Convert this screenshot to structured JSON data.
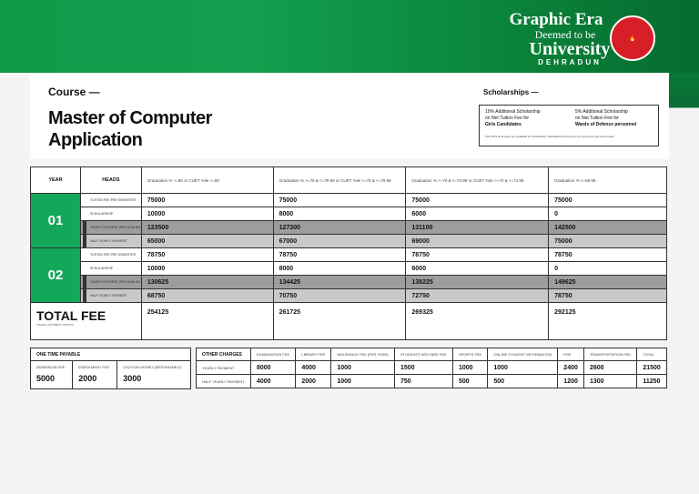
{
  "logo": {
    "name": "Graphic Era",
    "sub": "Deemed to be",
    "uni": "University",
    "city": "DEHRADUN",
    "seal": "GRAPHIC ERA"
  },
  "course_label": "Course —",
  "course_title": "Master of Computer Application",
  "scholarships": {
    "heading": "Scholarships —",
    "items": [
      {
        "line1": "10% Additional Scholarship",
        "line2": "on Net Tuition Fee for",
        "bold": "Girls Candidates"
      },
      {
        "line1": "5% Additional Scholarship",
        "line2": "on Net Tuition Fee for",
        "bold": "Wards of Defence personnel"
      }
    ],
    "note": "Only 25% of all seats are available for scholarship / Scholarship will be given on first come first serve basis."
  },
  "fee_table": {
    "year_header": "YEAR",
    "heads_header": "HEADS",
    "criteria": [
      "Graduation % >=80 or CUET %ile >=80",
      "Graduation % >=75 & <=79.99 or CUET %ile >=75 & <=79.99",
      "Graduation % >=70 & <=74.99 or CUET %ile >=70 & <=74.99",
      "Graduation % <=69.99"
    ],
    "years": [
      {
        "year": "01",
        "rows": [
          {
            "head": "Tuition Fee Per Semester",
            "values": [
              "75000",
              "75000",
              "75000",
              "75000"
            ]
          },
          {
            "head": "Scholarship",
            "values": [
              "10000",
              "8000",
              "6000",
              "0"
            ]
          },
          {
            "head": "Yearly Payment (Per Annum)",
            "values": [
              "123500",
              "127300",
              "131100",
              "142500"
            ]
          },
          {
            "head": "Half Yearly Payment",
            "values": [
              "65000",
              "67000",
              "69000",
              "75000"
            ]
          }
        ]
      },
      {
        "year": "02",
        "rows": [
          {
            "head": "Tuition Fee Per Semester",
            "values": [
              "78750",
              "78750",
              "78750",
              "78750"
            ]
          },
          {
            "head": "Scholarship",
            "values": [
              "10000",
              "8000",
              "6000",
              "0"
            ]
          },
          {
            "head": "Yearly Payment (Per Annum)",
            "values": [
              "130625",
              "134425",
              "138225",
              "149625"
            ]
          },
          {
            "head": "Half Yearly Payment",
            "values": [
              "68750",
              "70750",
              "72750",
              "78750"
            ]
          }
        ]
      }
    ],
    "total_label": "TOTAL FEE",
    "total_note": "(YEARLY PAYMENT OPTION)",
    "totals": [
      "254125",
      "261725",
      "269325",
      "292125"
    ]
  },
  "one_time": {
    "title": "ONE TIME PAYABLE",
    "items": [
      {
        "label": "ADMISSION FEE",
        "value": "5000"
      },
      {
        "label": "ENROLMENT FEE",
        "value": "2000"
      },
      {
        "label": "CAUTION MONEY (REFUNDABLE)",
        "value": "3000"
      }
    ]
  },
  "other": {
    "title": "OTHER CHARGES",
    "headers": [
      "EXAMINATION FEE",
      "LIBRARY FEE",
      "INSURANCE FEE (PER YEAR)",
      "STUDENTS WELFARE FEE",
      "SPORTS FEE",
      "ONLINE STUDENT INFORMATION",
      "PDP",
      "TRANSPORTATION FEE",
      "TOTAL"
    ],
    "rows": [
      {
        "label": "YEARLY PAYMENT",
        "values": [
          "8000",
          "4000",
          "1000",
          "1500",
          "1000",
          "1000",
          "2400",
          "2600",
          "21500"
        ]
      },
      {
        "label": "HALF YEARLY PAYMENT",
        "values": [
          "4000",
          "2000",
          "1000",
          "750",
          "500",
          "500",
          "1200",
          "1300",
          "11250"
        ]
      }
    ]
  }
}
